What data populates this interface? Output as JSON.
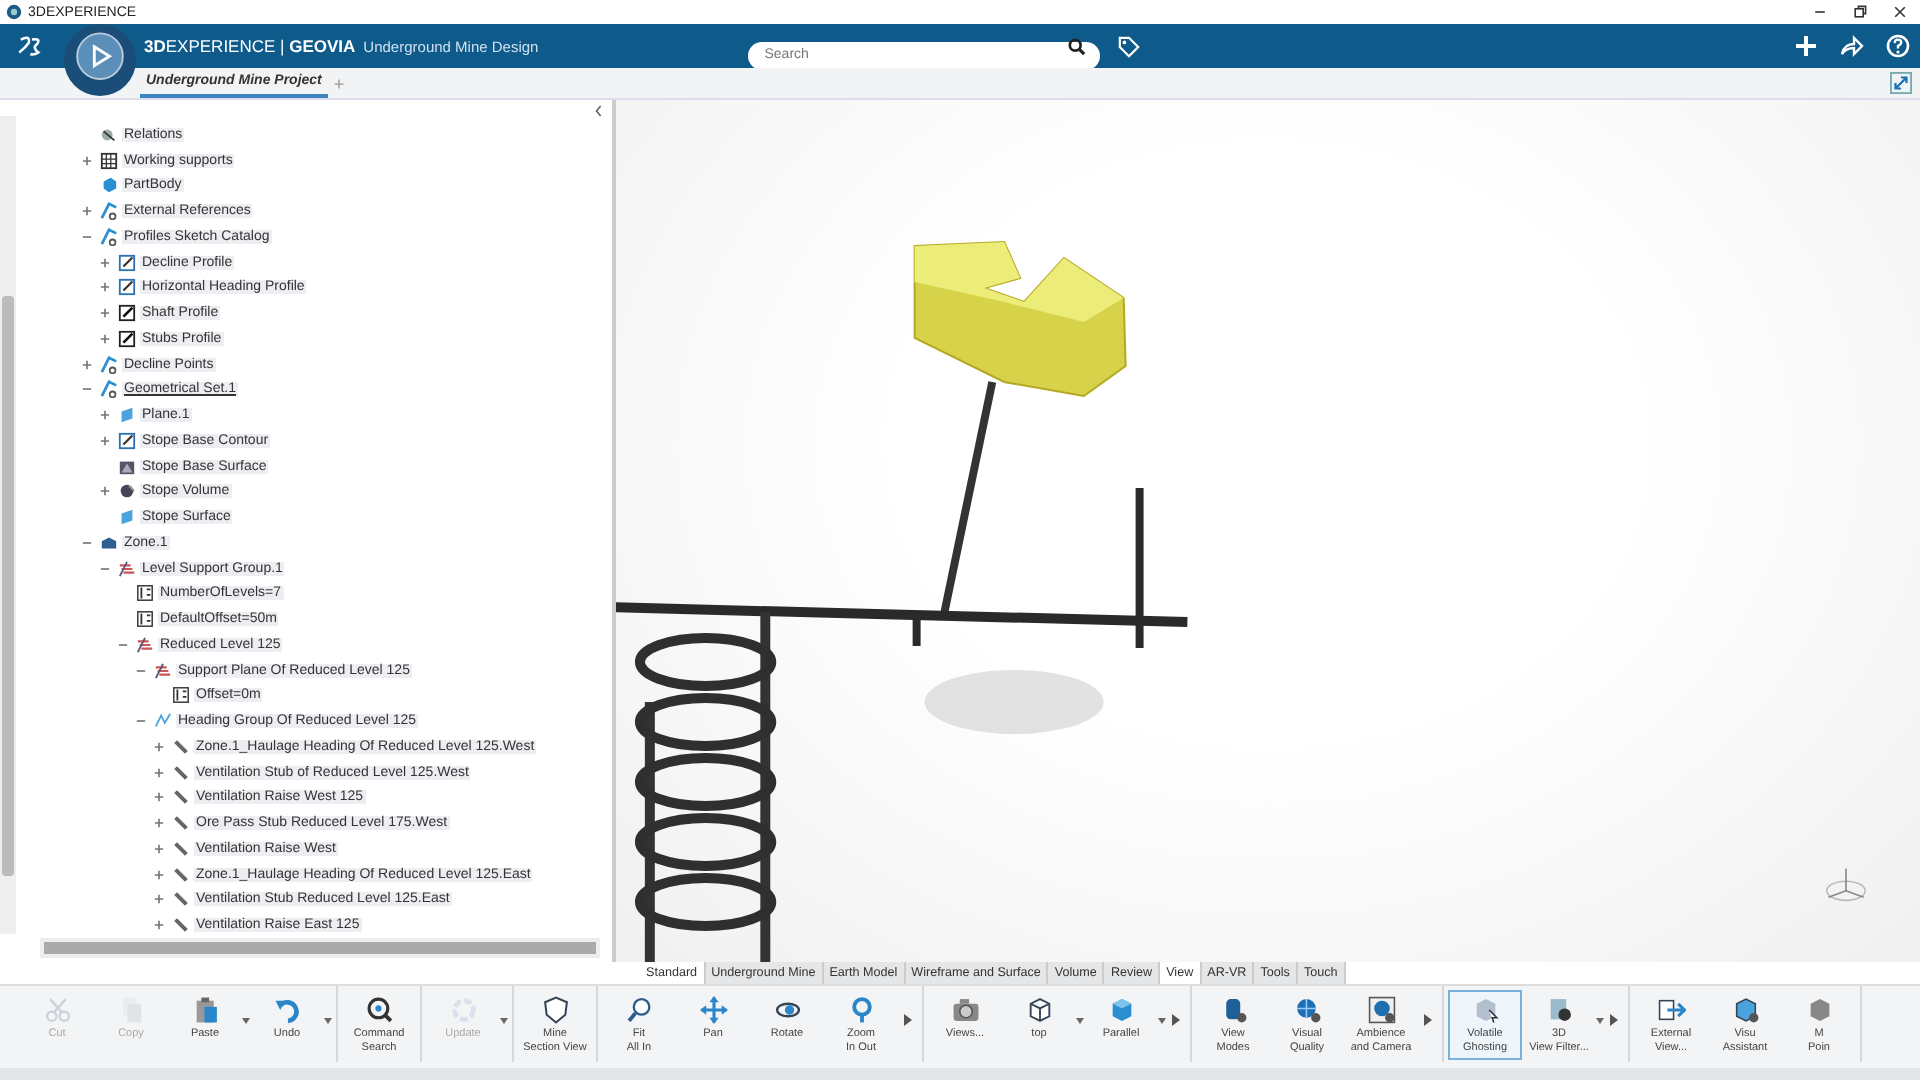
{
  "window": {
    "title": "3DEXPERIENCE"
  },
  "header": {
    "brand": "**3D**EXPERIENCE | **GEOVIA**",
    "app_name": "Underground Mine Design",
    "search": {
      "placeholder": "Search"
    }
  },
  "tabs": [
    {
      "label": "Underground Mine Project",
      "selected": true
    }
  ],
  "add_tab": "+",
  "tree": [
    {
      "label": "Relations",
      "kind": "relations",
      "expandable": false,
      "underlined": false
    },
    {
      "label": "Working supports",
      "kind": "grid",
      "expandable": true,
      "expanded": false,
      "underlined": false
    },
    {
      "label": "PartBody",
      "kind": "body",
      "expandable": false,
      "underlined": false
    },
    {
      "label": "External References",
      "kind": "geoset",
      "expandable": true,
      "expanded": false,
      "underlined": false
    },
    {
      "label": "Profiles Sketch Catalog",
      "kind": "geoset",
      "expandable": true,
      "expanded": true,
      "underlined": false,
      "children": [
        {
          "label": "Decline Profile",
          "kind": "sketch",
          "expandable": true,
          "expanded": false,
          "underlined": false
        },
        {
          "label": "Horizontal Heading Profile",
          "kind": "sketch",
          "expandable": true,
          "expanded": false,
          "underlined": false
        },
        {
          "label": "Shaft Profile",
          "kind": "sketch-dark",
          "expandable": true,
          "expanded": false,
          "underlined": false
        },
        {
          "label": "Stubs Profile",
          "kind": "sketch-dark",
          "expandable": true,
          "expanded": false,
          "underlined": false
        }
      ]
    },
    {
      "label": "Decline Points",
      "kind": "geoset",
      "expandable": true,
      "expanded": false,
      "underlined": false
    },
    {
      "label": "Geometrical Set.1",
      "kind": "geoset",
      "expandable": true,
      "expanded": true,
      "underlined": true,
      "children": [
        {
          "label": "Plane.1",
          "kind": "plane",
          "expandable": true,
          "expanded": false,
          "underlined": false
        },
        {
          "label": "Stope Base Contour",
          "kind": "sketch",
          "expandable": true,
          "expanded": false,
          "underlined": false
        },
        {
          "label": "Stope Base Surface",
          "kind": "surface",
          "expandable": false,
          "underlined": false
        },
        {
          "label": "Stope Volume",
          "kind": "volume",
          "expandable": true,
          "expanded": false,
          "underlined": false
        },
        {
          "label": "Stope Surface",
          "kind": "plane",
          "expandable": false,
          "underlined": false
        }
      ]
    },
    {
      "label": "Zone.1",
      "kind": "zone",
      "expandable": true,
      "expanded": true,
      "underlined": false,
      "children": [
        {
          "label": "Level Support Group.1",
          "kind": "levels",
          "expandable": true,
          "expanded": true,
          "underlined": false,
          "children": [
            {
              "label": "NumberOfLevels=7",
              "kind": "param",
              "expandable": false,
              "underlined": false
            },
            {
              "label": "DefaultOffset=50m",
              "kind": "param",
              "expandable": false,
              "underlined": false
            },
            {
              "label": "Reduced Level 125",
              "kind": "levels",
              "expandable": true,
              "expanded": true,
              "underlined": false,
              "children": [
                {
                  "label": "Support Plane Of Reduced Level 125",
                  "kind": "levels",
                  "expandable": true,
                  "expanded": true,
                  "underlined": false,
                  "children": [
                    {
                      "label": "Offset=0m",
                      "kind": "param",
                      "expandable": false,
                      "underlined": false
                    }
                  ]
                },
                {
                  "label": "Heading Group Of Reduced Level 125",
                  "kind": "heading-group",
                  "expandable": true,
                  "expanded": true,
                  "underlined": false,
                  "children": [
                    {
                      "label": "Zone.1_Haulage Heading Of Reduced Level 125.West",
                      "kind": "heading",
                      "expandable": true,
                      "expanded": false,
                      "underlined": false
                    },
                    {
                      "label": "Ventilation Stub of Reduced Level 125.West",
                      "kind": "heading",
                      "expandable": true,
                      "expanded": false,
                      "underlined": false
                    },
                    {
                      "label": "Ventilation Raise West 125",
                      "kind": "heading",
                      "expandable": true,
                      "expanded": false,
                      "underlined": false
                    },
                    {
                      "label": "Ore Pass Stub Reduced Level 175.West",
                      "kind": "heading",
                      "expandable": true,
                      "expanded": false,
                      "underlined": false
                    },
                    {
                      "label": "Ventilation Raise West",
                      "kind": "heading",
                      "expandable": true,
                      "expanded": false,
                      "underlined": false
                    },
                    {
                      "label": "Zone.1_Haulage Heading Of Reduced Level 125.East",
                      "kind": "heading",
                      "expandable": true,
                      "expanded": false,
                      "underlined": false
                    },
                    {
                      "label": "Ventilation Stub Reduced Level 125.East",
                      "kind": "heading",
                      "expandable": true,
                      "expanded": false,
                      "underlined": false
                    },
                    {
                      "label": "Ventilation Raise East 125",
                      "kind": "heading",
                      "expandable": true,
                      "expanded": false,
                      "underlined": false
                    }
                  ]
                }
              ]
            }
          ]
        }
      ]
    }
  ],
  "workbench_tabs": [
    {
      "label": "Standard",
      "selected": true
    },
    {
      "label": "Underground Mine",
      "selected": false
    },
    {
      "label": "Earth Model",
      "selected": false
    },
    {
      "label": "Wireframe and Surface",
      "selected": false
    },
    {
      "label": "Volume",
      "selected": false
    },
    {
      "label": "Review",
      "selected": false
    },
    {
      "label": "View",
      "selected": true
    },
    {
      "label": "AR-VR",
      "selected": false
    },
    {
      "label": "Tools",
      "selected": false
    },
    {
      "label": "Touch",
      "selected": false
    }
  ],
  "toolbar": [
    {
      "more": false,
      "items": [
        {
          "lines": [
            "Cut"
          ],
          "disabled": true,
          "dropdown": false,
          "selected": false
        },
        {
          "lines": [
            "Copy"
          ],
          "disabled": true,
          "dropdown": false,
          "selected": false
        },
        {
          "lines": [
            "Paste"
          ],
          "disabled": false,
          "dropdown": true,
          "selected": false
        },
        {
          "lines": [
            "Undo"
          ],
          "disabled": false,
          "dropdown": true,
          "selected": false
        }
      ]
    },
    {
      "more": false,
      "items": [
        {
          "lines": [
            "Command",
            "Search"
          ],
          "disabled": false,
          "dropdown": false,
          "selected": false
        }
      ]
    },
    {
      "more": false,
      "items": [
        {
          "lines": [
            "Update"
          ],
          "disabled": true,
          "dropdown": true,
          "selected": false
        }
      ]
    },
    {
      "more": false,
      "items": [
        {
          "lines": [
            "Mine",
            "Section View"
          ],
          "disabled": false,
          "dropdown": false,
          "selected": false
        }
      ]
    },
    {
      "more": true,
      "items": [
        {
          "lines": [
            "Fit",
            "All In"
          ],
          "disabled": false,
          "dropdown": false,
          "selected": false
        },
        {
          "lines": [
            "Pan"
          ],
          "disabled": false,
          "dropdown": false,
          "selected": false
        },
        {
          "lines": [
            "Rotate"
          ],
          "disabled": false,
          "dropdown": false,
          "selected": false
        },
        {
          "lines": [
            "Zoom",
            "In Out"
          ],
          "disabled": false,
          "dropdown": false,
          "selected": false
        }
      ]
    },
    {
      "more": true,
      "items": [
        {
          "lines": [
            "Views..."
          ],
          "disabled": false,
          "dropdown": false,
          "selected": false
        },
        {
          "lines": [
            "top"
          ],
          "disabled": false,
          "dropdown": true,
          "selected": false
        },
        {
          "lines": [
            "Parallel"
          ],
          "disabled": false,
          "dropdown": true,
          "selected": false
        }
      ]
    },
    {
      "more": true,
      "items": [
        {
          "lines": [
            "View",
            "Modes"
          ],
          "disabled": false,
          "dropdown": false,
          "selected": false
        },
        {
          "lines": [
            "Visual",
            "Quality"
          ],
          "disabled": false,
          "dropdown": false,
          "selected": false
        },
        {
          "lines": [
            "Ambience",
            "and Camera"
          ],
          "disabled": false,
          "dropdown": false,
          "selected": false
        }
      ]
    },
    {
      "more": true,
      "items": [
        {
          "lines": [
            "Volatile",
            "Ghosting"
          ],
          "disabled": false,
          "dropdown": false,
          "selected": true
        },
        {
          "lines": [
            "3D",
            "View Filter..."
          ],
          "disabled": false,
          "dropdown": true,
          "selected": false
        }
      ]
    },
    {
      "more": false,
      "items": [
        {
          "lines": [
            "External",
            "View..."
          ],
          "disabled": false,
          "dropdown": false,
          "selected": false
        },
        {
          "lines": [
            "Visu",
            "Assistant"
          ],
          "disabled": false,
          "dropdown": false,
          "selected": false
        },
        {
          "lines": [
            "M",
            "Poin"
          ],
          "disabled": false,
          "dropdown": false,
          "selected": false
        }
      ]
    }
  ]
}
